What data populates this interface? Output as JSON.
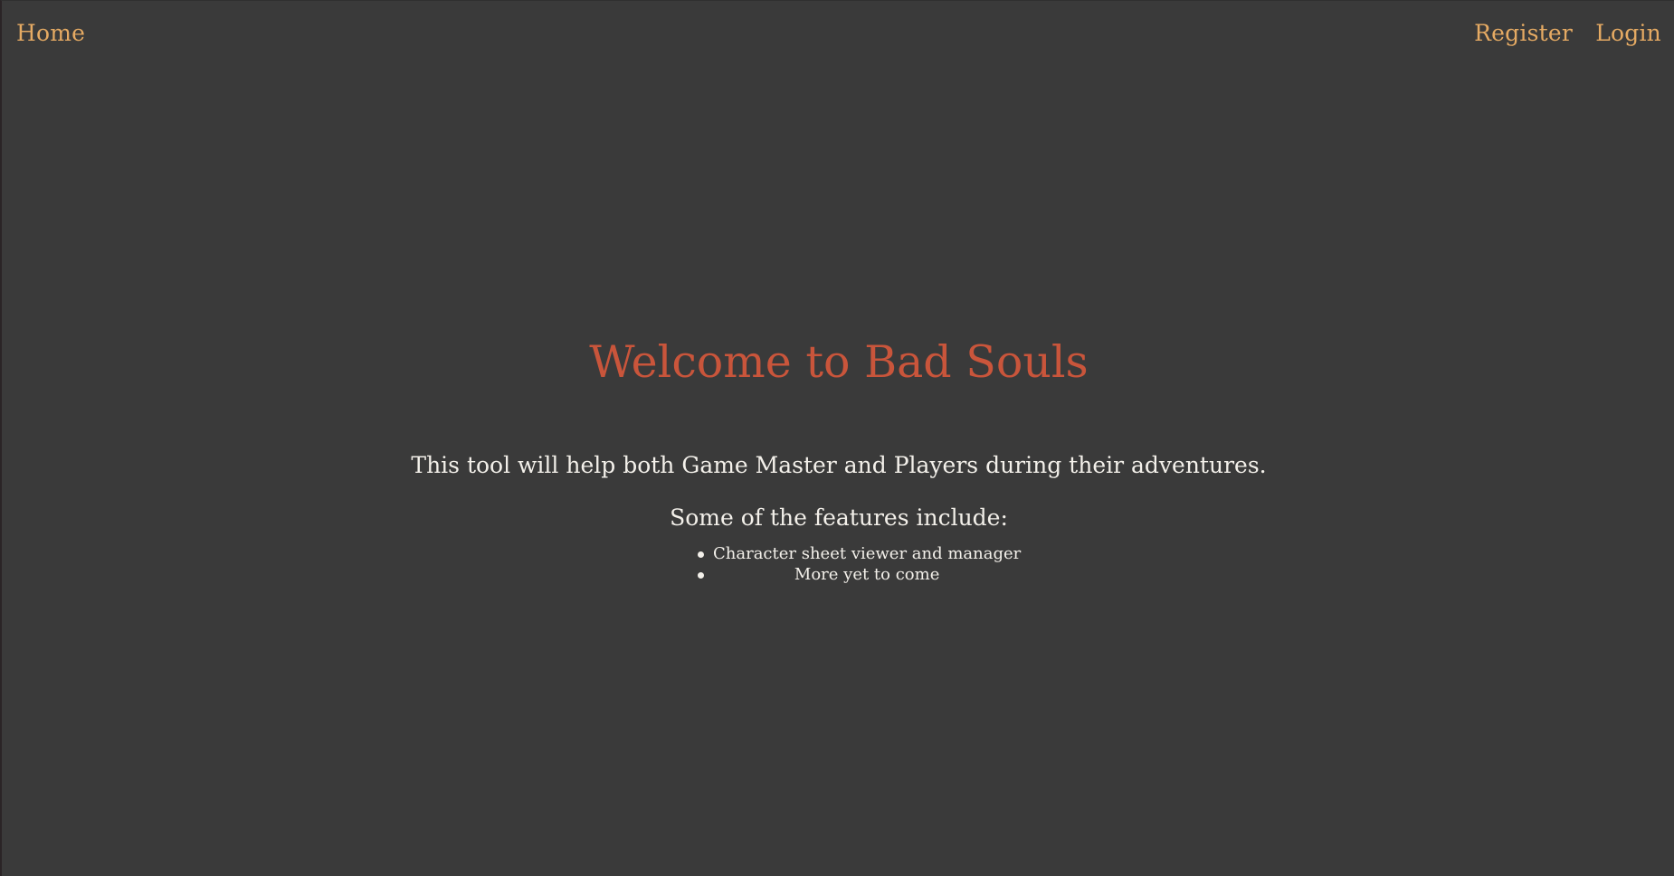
{
  "nav": {
    "home_label": "Home",
    "register_label": "Register",
    "login_label": "Login"
  },
  "main": {
    "title": "Welcome to Bad Souls",
    "intro": "This tool will help both Game Master and Players during their adventures.",
    "features_heading": "Some of the features include:",
    "features": [
      "Character sheet viewer and manager",
      "More yet to come"
    ]
  },
  "colors": {
    "background": "#3a3a3a",
    "nav_link": "#e5aa63",
    "title": "#c9553b",
    "text": "#f3f0ea"
  }
}
